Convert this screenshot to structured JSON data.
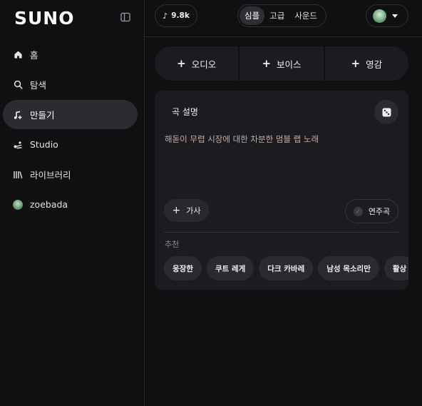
{
  "sidebar": {
    "logo": "SUNO",
    "items": [
      {
        "label": "홈",
        "icon": "home-icon"
      },
      {
        "label": "탐색",
        "icon": "search-icon"
      },
      {
        "label": "만들기",
        "icon": "music-note-plus-icon",
        "active": true
      },
      {
        "label": "Studio",
        "icon": "studio-icon"
      },
      {
        "label": "라이브러리",
        "icon": "library-icon"
      },
      {
        "label": "zoebada",
        "icon": "avatar"
      }
    ]
  },
  "topbar": {
    "credits": "9.8k",
    "modes": [
      "심플",
      "고급",
      "사운드"
    ],
    "active_mode": "심플"
  },
  "add_buttons": [
    "오디오",
    "보이스",
    "영감"
  ],
  "card": {
    "title": "곡 설명",
    "description": "해돋이 무렵 시장에 대한 차분한 멈블 랩 노래",
    "lyrics_button": "가사",
    "instrumental_button": "연주곡",
    "recommend_label": "추천",
    "chips": [
      "웅장한",
      "쿠트 레게",
      "다크 카바레",
      "남성 목소리만",
      "활상"
    ]
  },
  "colors": {
    "background": "#101013",
    "panel": "#1c1c20",
    "active_nav": "#2b2b30",
    "description_text": "#c9a9a3"
  }
}
